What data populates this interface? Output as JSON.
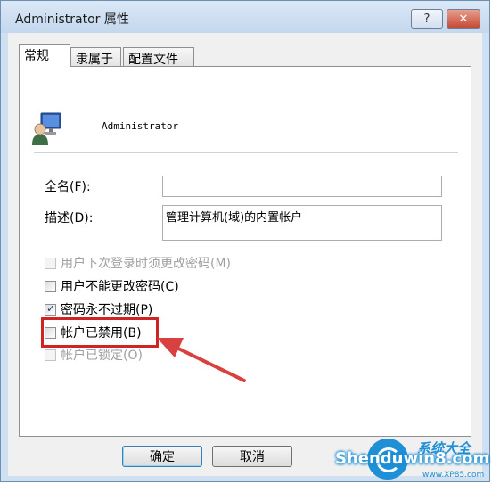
{
  "window": {
    "title": "Administrator 属性",
    "help_label": "?",
    "close_label": "✕"
  },
  "tabs": [
    {
      "label": "常规",
      "active": true
    },
    {
      "label": "隶属于",
      "active": false
    },
    {
      "label": "配置文件",
      "active": false
    }
  ],
  "general": {
    "username": "Administrator",
    "fullname_label": "全名(F):",
    "fullname_value": "",
    "description_label": "描述(D):",
    "description_value": "管理计算机(域)的内置帐户",
    "checkboxes": [
      {
        "label": "用户下次登录时须更改密码(M)",
        "checked": false,
        "enabled": false
      },
      {
        "label": "用户不能更改密码(C)",
        "checked": false,
        "enabled": true
      },
      {
        "label": "密码永不过期(P)",
        "checked": true,
        "enabled": true
      },
      {
        "label": "帐户已禁用(B)",
        "checked": false,
        "enabled": true
      },
      {
        "label": "帐户已锁定(O)",
        "checked": false,
        "enabled": false
      }
    ]
  },
  "buttons": {
    "ok": "确定",
    "cancel": "取消"
  },
  "watermark": {
    "main": "Shenduwin8.com",
    "cn": "系统大全",
    "sub": "www.XP85.com"
  },
  "colors": {
    "highlight": "#d02424",
    "title_bg": "#cfe0f2",
    "watermark": "#1f8fd6"
  },
  "icons": {
    "user": "user-account-icon"
  }
}
